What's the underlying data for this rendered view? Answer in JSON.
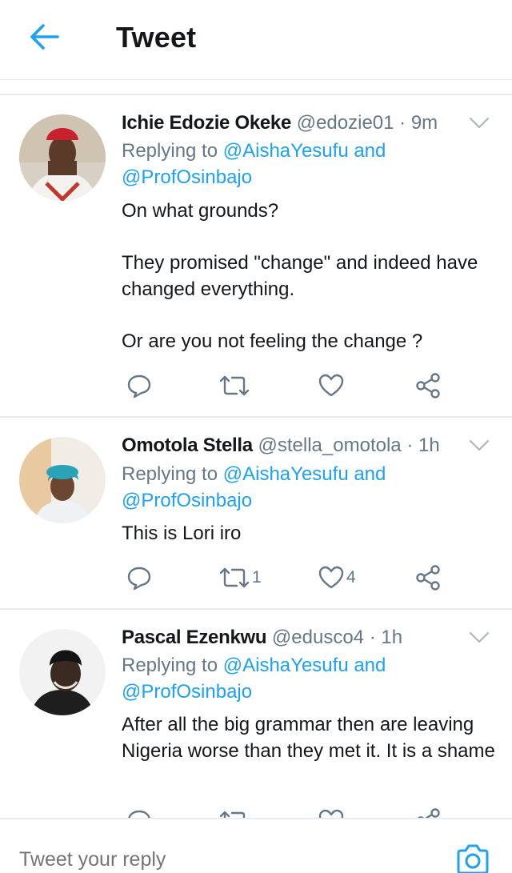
{
  "header": {
    "title": "Tweet",
    "back_icon": "arrow-left-icon",
    "accent": "#1da1f2"
  },
  "tweets": [
    {
      "name": "Ichie Edozie Okeke",
      "handle": "@edozie01",
      "sep": "·",
      "time": "9m",
      "replying_prefix": "Replying to",
      "replying_to": "@AishaYesufu and",
      "replying_to2": "@ProfOsinbajo",
      "body": [
        "On what grounds?",
        "They promised \"change\" and indeed have changed everything.",
        "Or are you not feeling the change ?"
      ],
      "retweets": "",
      "likes": ""
    },
    {
      "name": "Omotola Stella",
      "handle": "@stella_omotola",
      "sep": "·",
      "time": "1h",
      "replying_prefix": "Replying to",
      "replying_to": "@AishaYesufu and",
      "replying_to2": "@ProfOsinbajo",
      "body": [
        "This is Lori iro"
      ],
      "retweets": "1",
      "likes": "4"
    },
    {
      "name": "Pascal Ezenkwu",
      "handle": "@edusco4",
      "sep": "·",
      "time": "1h",
      "replying_prefix": "Replying to",
      "replying_to": "@AishaYesufu and",
      "replying_to2": "@ProfOsinbajo",
      "body": [
        "After all the big grammar then are leaving Nigeria worse than they met it. It is a shame"
      ],
      "retweets": "",
      "likes": ""
    }
  ],
  "composer": {
    "placeholder": "Tweet your reply",
    "camera_icon": "camera-icon"
  },
  "colors": {
    "link": "#1da1f2",
    "muted": "#657786",
    "text": "#14171a",
    "divider": "#e6ecf0"
  }
}
